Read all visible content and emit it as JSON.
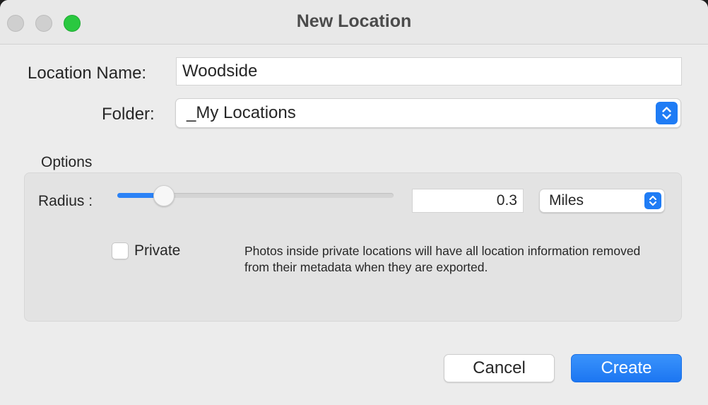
{
  "window": {
    "title": "New Location"
  },
  "form": {
    "location_name_label": "Location Name:",
    "location_name_value": "Woodside",
    "folder_label": "Folder:",
    "folder_value": "_My Locations"
  },
  "options": {
    "group_label": "Options",
    "radius_label": "Radius :",
    "radius_slider_fraction": 0.17,
    "radius_value": "0.3",
    "unit_value": "Miles",
    "private_label": "Private",
    "private_checked": false,
    "private_note": "Photos inside private locations will have all location information removed from their metadata when they are exported."
  },
  "buttons": {
    "cancel_label": "Cancel",
    "create_label": "Create"
  },
  "colors": {
    "accent": "#1f7cf5",
    "close_button_inactive": "#cfcfcf",
    "zoom_button": "#2ac840"
  },
  "icons": {
    "popup_arrows": "up-down-chevron-icon"
  }
}
